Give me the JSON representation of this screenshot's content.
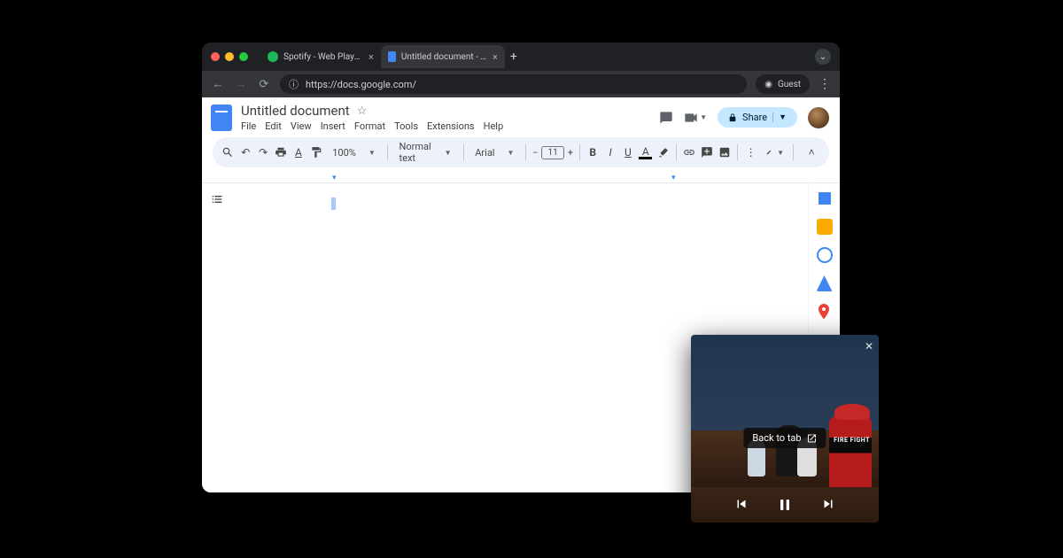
{
  "browser": {
    "tabs": [
      {
        "title": "Spotify - Web Player: Music f",
        "favicon": "spotify"
      },
      {
        "title": "Untitled document - Google D",
        "favicon": "docs",
        "active": true
      }
    ],
    "url": "https://docs.google.com/",
    "guest_label": "Guest"
  },
  "docs": {
    "title": "Untitled document",
    "menus": [
      "File",
      "Edit",
      "View",
      "Insert",
      "Format",
      "Tools",
      "Extensions",
      "Help"
    ],
    "share_label": "Share",
    "zoom": "100%",
    "style_select": "Normal text",
    "font_select": "Arial",
    "font_size": "11"
  },
  "sidebar_colors": [
    "#f9ab00",
    "#f9ab00",
    "#4285f4",
    "#34a853",
    "#ea4335",
    "#4285f4",
    "#ea4335"
  ],
  "pip": {
    "back_label": "Back to tab",
    "fire_text": "FIRE\nFIGHT"
  }
}
